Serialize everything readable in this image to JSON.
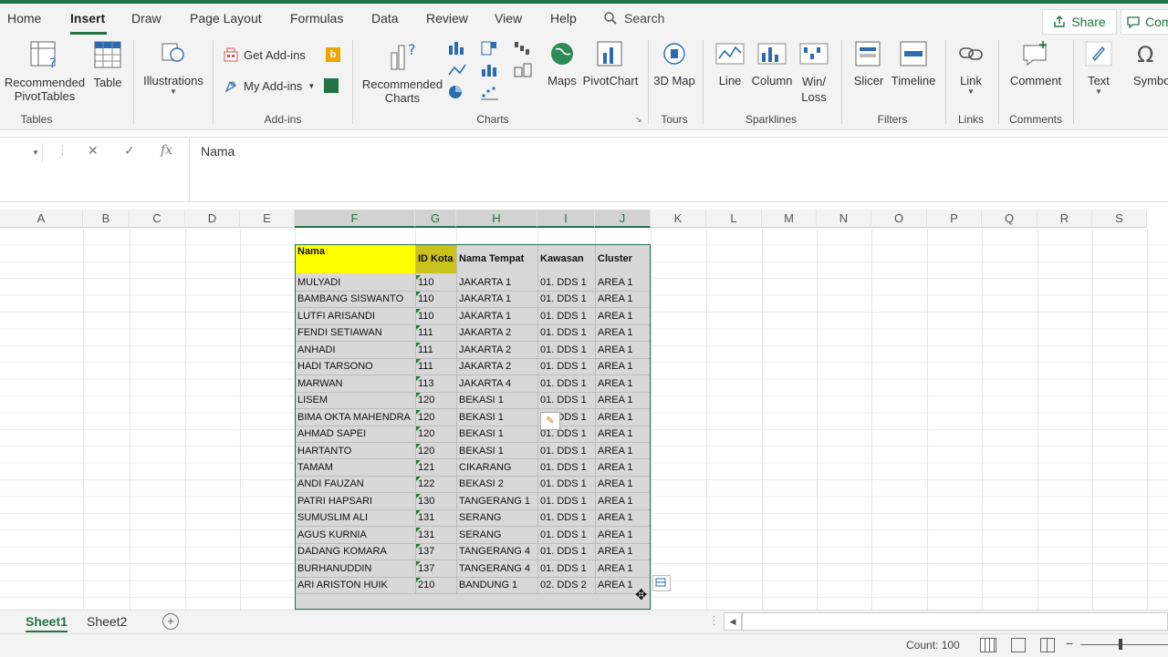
{
  "menu": {
    "tabs": [
      "Home",
      "Insert",
      "Draw",
      "Page Layout",
      "Formulas",
      "Data",
      "Review",
      "View",
      "Help"
    ],
    "search": "Search",
    "share": "Share",
    "comments": "Com"
  },
  "ribbon": {
    "tables": {
      "pivot": "Recommended PivotTables",
      "table": "Table",
      "label": "Tables"
    },
    "illustrations": "Illustrations",
    "addins": {
      "get": "Get Add-ins",
      "my": "My Add-ins",
      "label": "Add-ins"
    },
    "charts": {
      "recommended": "Recommended Charts",
      "maps": "Maps",
      "pivotchart": "PivotChart",
      "label": "Charts"
    },
    "tours": {
      "map3d": "3D Map",
      "label": "Tours"
    },
    "sparklines": {
      "line": "Line",
      "column": "Column",
      "winloss": "Win/ Loss",
      "label": "Sparklines"
    },
    "filters": {
      "slicer": "Slicer",
      "timeline": "Timeline",
      "label": "Filters"
    },
    "links": {
      "link": "Link",
      "label": "Links"
    },
    "comments": {
      "comment": "Comment",
      "label": "Comments"
    },
    "text": {
      "text": "Text",
      "symbols": "Symbo"
    }
  },
  "formula_bar": {
    "content": "Nama",
    "fx": "fx"
  },
  "columns": [
    "A",
    "B",
    "C",
    "D",
    "E",
    "F",
    "G",
    "H",
    "I",
    "J",
    "K",
    "L",
    "M",
    "N",
    "O",
    "P",
    "Q",
    "R",
    "S"
  ],
  "table": {
    "headers": [
      "Nama",
      "ID Kota",
      "Nama Tempat",
      "Kawasan",
      "Cluster"
    ],
    "rows": [
      [
        "MULYADI",
        "110",
        "JAKARTA 1",
        "01. DDS 1",
        "AREA 1"
      ],
      [
        "BAMBANG SISWANTO",
        "110",
        "JAKARTA 1",
        "01. DDS 1",
        "AREA 1"
      ],
      [
        "LUTFI ARISANDI",
        "110",
        "JAKARTA 1",
        "01. DDS 1",
        "AREA 1"
      ],
      [
        "FENDI SETIAWAN",
        "111",
        "JAKARTA 2",
        "01. DDS 1",
        "AREA 1"
      ],
      [
        "ANHADI",
        "111",
        "JAKARTA 2",
        "01. DDS 1",
        "AREA 1"
      ],
      [
        "HADI TARSONO",
        "111",
        "JAKARTA 2",
        "01. DDS 1",
        "AREA 1"
      ],
      [
        "MARWAN",
        "113",
        "JAKARTA 4",
        "01. DDS 1",
        "AREA 1"
      ],
      [
        "LISEM",
        "120",
        "BEKASI 1",
        "01. DDS 1",
        "AREA 1"
      ],
      [
        "BIMA OKTA MAHENDRA",
        "120",
        "BEKASI 1",
        "01. DDS 1",
        "AREA 1"
      ],
      [
        "AHMAD SAPEI",
        "120",
        "BEKASI 1",
        "01. DDS 1",
        "AREA 1"
      ],
      [
        "HARTANTO",
        "120",
        "BEKASI 1",
        "01. DDS 1",
        "AREA 1"
      ],
      [
        "TAMAM",
        "121",
        "CIKARANG",
        "01. DDS 1",
        "AREA 1"
      ],
      [
        "ANDI FAUZAN",
        "122",
        "BEKASI 2",
        "01. DDS 1",
        "AREA 1"
      ],
      [
        "PATRI HAPSARI",
        "130",
        "TANGERANG 1",
        "01. DDS 1",
        "AREA 1"
      ],
      [
        "SUMUSLIM ALI",
        "131",
        "SERANG",
        "01. DDS 1",
        "AREA 1"
      ],
      [
        "AGUS KURNIA",
        "131",
        "SERANG",
        "01. DDS 1",
        "AREA 1"
      ],
      [
        "DADANG KOMARA",
        "137",
        "TANGERANG 4",
        "01. DDS 1",
        "AREA 1"
      ],
      [
        "BURHANUDDIN",
        "137",
        "TANGERANG 4",
        "01. DDS 1",
        "AREA 1"
      ],
      [
        "ARI ARISTON HUIK",
        "210",
        "BANDUNG 1",
        "02. DDS 2",
        "AREA 1"
      ]
    ]
  },
  "sheets": [
    "Sheet1",
    "Sheet2"
  ],
  "status": {
    "count": "Count: 100"
  },
  "colors": {
    "accent": "#217346",
    "header_yellow": "#ffff00",
    "header_olive": "#c9c21a",
    "selection": "#d8d8d8"
  }
}
